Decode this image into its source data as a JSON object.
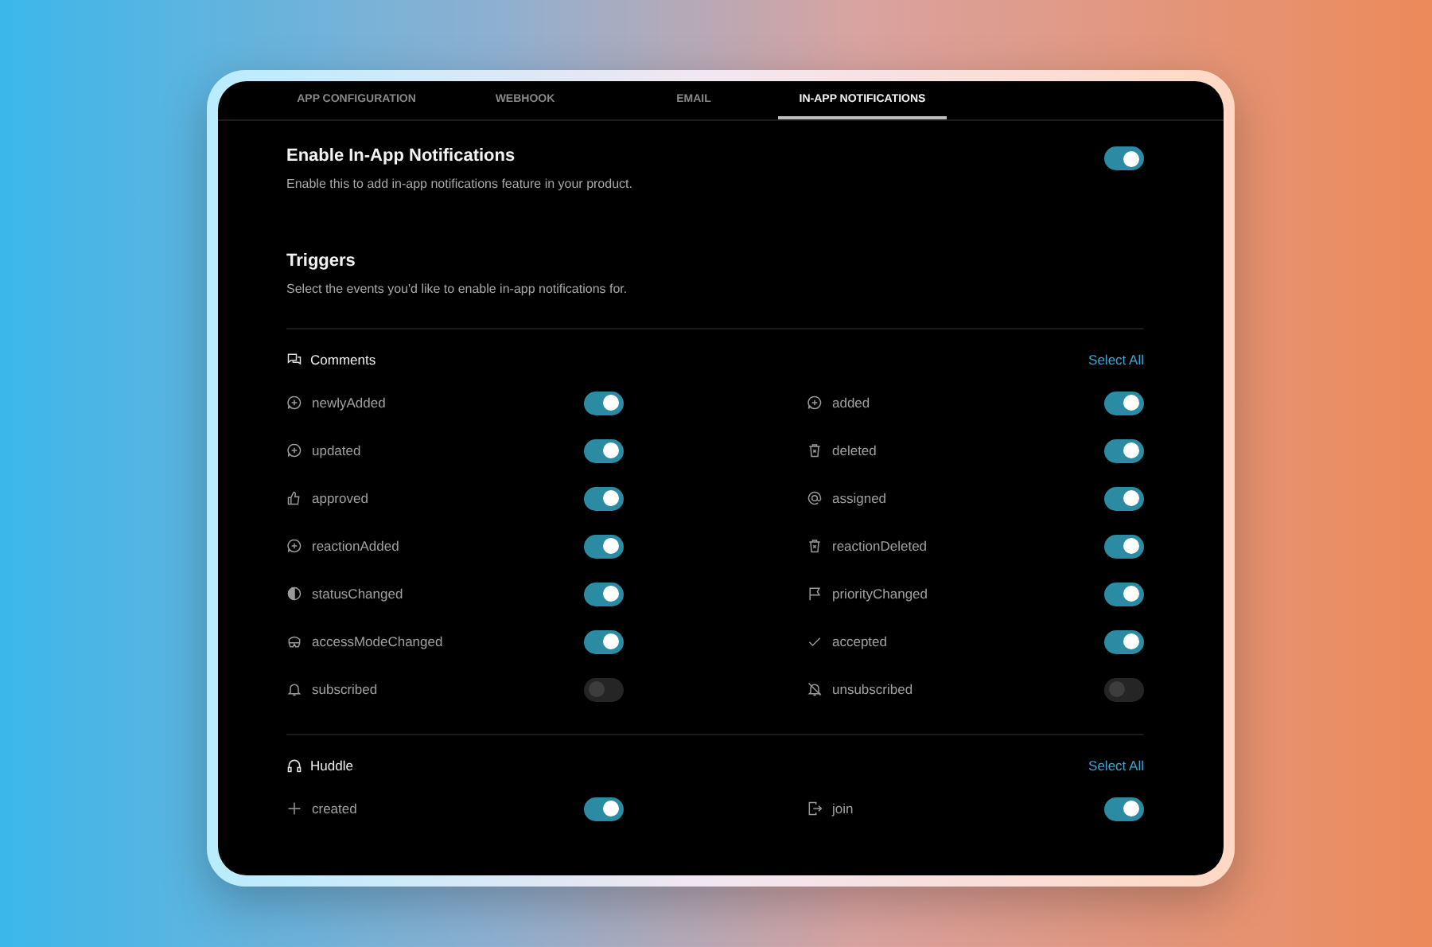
{
  "tabs": [
    {
      "label": "APP CONFIGURATION",
      "selected": false
    },
    {
      "label": "WEBHOOK",
      "selected": false
    },
    {
      "label": "EMAIL",
      "selected": false
    },
    {
      "label": "IN-APP NOTIFICATIONS",
      "selected": true
    }
  ],
  "enable": {
    "title": "Enable In-App Notifications",
    "description": "Enable this to add in-app notifications feature in your product.",
    "on": true
  },
  "triggers": {
    "title": "Triggers",
    "description": "Select the events you'd like to enable in-app notifications for."
  },
  "sections": [
    {
      "title": "Comments",
      "select_all": "Select All",
      "items": [
        {
          "label": "newlyAdded",
          "on": true
        },
        {
          "label": "added",
          "on": true
        },
        {
          "label": "updated",
          "on": true
        },
        {
          "label": "deleted",
          "on": true
        },
        {
          "label": "approved",
          "on": true
        },
        {
          "label": "assigned",
          "on": true
        },
        {
          "label": "reactionAdded",
          "on": true
        },
        {
          "label": "reactionDeleted",
          "on": true
        },
        {
          "label": "statusChanged",
          "on": true
        },
        {
          "label": "priorityChanged",
          "on": true
        },
        {
          "label": "accessModeChanged",
          "on": true
        },
        {
          "label": "accepted",
          "on": true
        },
        {
          "label": "subscribed",
          "on": false
        },
        {
          "label": "unsubscribed",
          "on": false
        }
      ]
    },
    {
      "title": "Huddle",
      "select_all": "Select All",
      "items": [
        {
          "label": "created",
          "on": true
        },
        {
          "label": "join",
          "on": true
        }
      ]
    }
  ]
}
